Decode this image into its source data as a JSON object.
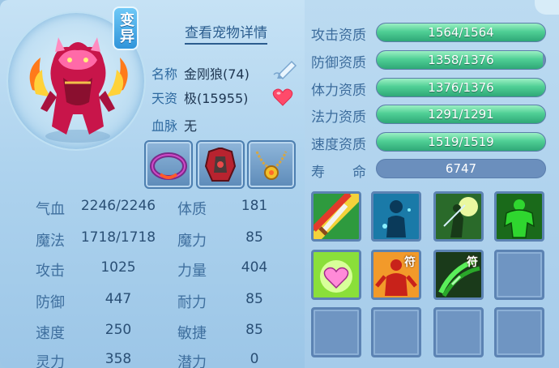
{
  "pet": {
    "mutant_badge": "变异",
    "detail_link": "查看宠物详情",
    "name_label": "名称",
    "name_value": "金刚狼(74)",
    "talent_label": "天资",
    "talent_value": "极(15955)",
    "bloodline_label": "血脉",
    "bloodline_value": "无"
  },
  "stats": [
    {
      "label": "气血",
      "value": "2246/2246",
      "label2": "体质",
      "value2": "181"
    },
    {
      "label": "魔法",
      "value": "1718/1718",
      "label2": "魔力",
      "value2": "85"
    },
    {
      "label": "攻击",
      "value": "1025",
      "label2": "力量",
      "value2": "404"
    },
    {
      "label": "防御",
      "value": "447",
      "label2": "耐力",
      "value2": "85"
    },
    {
      "label": "速度",
      "value": "250",
      "label2": "敏捷",
      "value2": "85"
    },
    {
      "label": "灵力",
      "value": "358",
      "label2": "潜力",
      "value2": "0"
    }
  ],
  "aptitudes": [
    {
      "label": "攻击资质",
      "text": "1564/1564",
      "fraction": 1.0
    },
    {
      "label": "防御资质",
      "text": "1358/1376",
      "fraction": 0.987
    },
    {
      "label": "体力资质",
      "text": "1376/1376",
      "fraction": 1.0
    },
    {
      "label": "法力资质",
      "text": "1291/1291",
      "fraction": 1.0
    },
    {
      "label": "速度资质",
      "text": "1519/1519",
      "fraction": 1.0
    }
  ],
  "lifespan": {
    "label": "寿　　命",
    "value": "6747"
  },
  "skills": [
    {
      "icon": "sword-strike-icon",
      "fu": ""
    },
    {
      "icon": "spirit-figure-icon",
      "fu": ""
    },
    {
      "icon": "shadow-warrior-icon",
      "fu": ""
    },
    {
      "icon": "green-strongman-icon",
      "fu": ""
    },
    {
      "icon": "heart-glow-icon",
      "fu": ""
    },
    {
      "icon": "red-figure-talisman-icon",
      "fu": "符"
    },
    {
      "icon": "green-claw-talisman-icon",
      "fu": "符"
    }
  ],
  "colors": {
    "bar_fill": "#4fcf95",
    "bar_empty": "#6c8db3",
    "label": "#3c6c9c"
  }
}
